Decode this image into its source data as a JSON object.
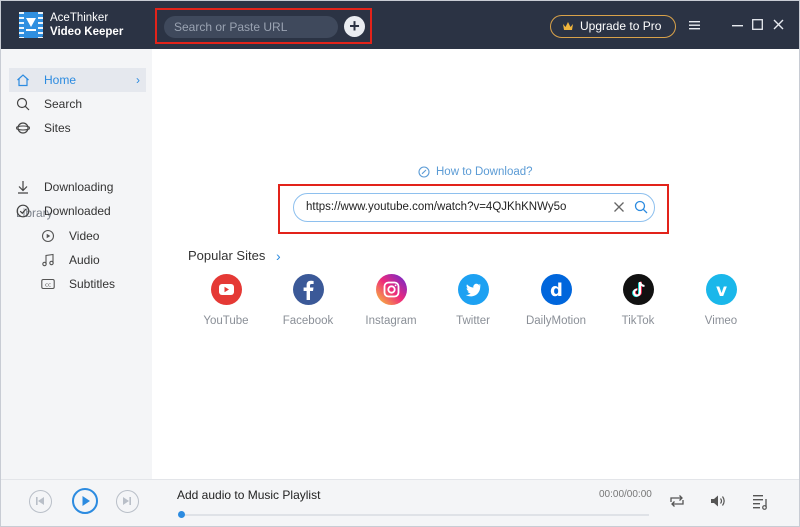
{
  "app": {
    "name_line1": "AceThinker",
    "name_line2": "Video Keeper"
  },
  "header": {
    "search_placeholder": "Search or Paste URL",
    "add_label": "+",
    "upgrade_label": "Upgrade to Pro"
  },
  "sidebar": {
    "home": "Home",
    "search": "Search",
    "sites": "Sites",
    "library_header": "Library",
    "downloading": "Downloading",
    "downloaded": "Downloaded",
    "video": "Video",
    "audio": "Audio",
    "subtitles": "Subtitles"
  },
  "main": {
    "how_to_download": "How to Download?",
    "url_value": "https://www.youtube.com/watch?v=4QJKhKNWy5o",
    "popular_sites_title": "Popular Sites",
    "sites": [
      {
        "name": "YouTube",
        "color": "#e53935"
      },
      {
        "name": "Facebook",
        "color": "#3b5998"
      },
      {
        "name": "Instagram",
        "color": "#d6249f"
      },
      {
        "name": "Twitter",
        "color": "#1da1f2"
      },
      {
        "name": "DailyMotion",
        "color": "#0066dc"
      },
      {
        "name": "TikTok",
        "color": "#111111"
      },
      {
        "name": "Vimeo",
        "color": "#1ab7ea"
      }
    ]
  },
  "player": {
    "track_title": "Add audio to Music Playlist",
    "time": "00:00/00:00",
    "progress": 0
  },
  "colors": {
    "titlebar": "#2b3344",
    "accent": "#2c8be0",
    "highlight": "#e2231a",
    "upgrade_border": "#d9a24a"
  }
}
